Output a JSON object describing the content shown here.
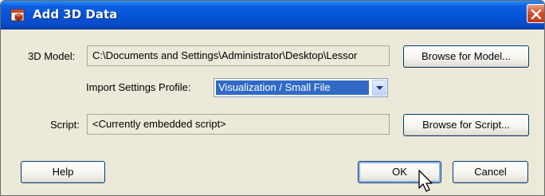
{
  "window": {
    "title": "Add 3D Data",
    "title_icon": "3d-data-icon",
    "close_icon": "close-icon"
  },
  "model": {
    "label": "3D Model:",
    "path": "C:\\Documents and Settings\\Administrator\\Desktop\\Lessor",
    "browse_label": "Browse for Model..."
  },
  "profile": {
    "label": "Import Settings Profile:",
    "selected": "Visualization / Small File"
  },
  "script": {
    "label": "Script:",
    "value": "<Currently embedded script>",
    "browse_label": "Browse for Script..."
  },
  "buttons": {
    "help": "Help",
    "ok": "OK",
    "cancel": "Cancel"
  },
  "colors": {
    "titlebar": "#0553d6",
    "selection": "#316ac5",
    "dialog_bg": "#ece9d8"
  }
}
